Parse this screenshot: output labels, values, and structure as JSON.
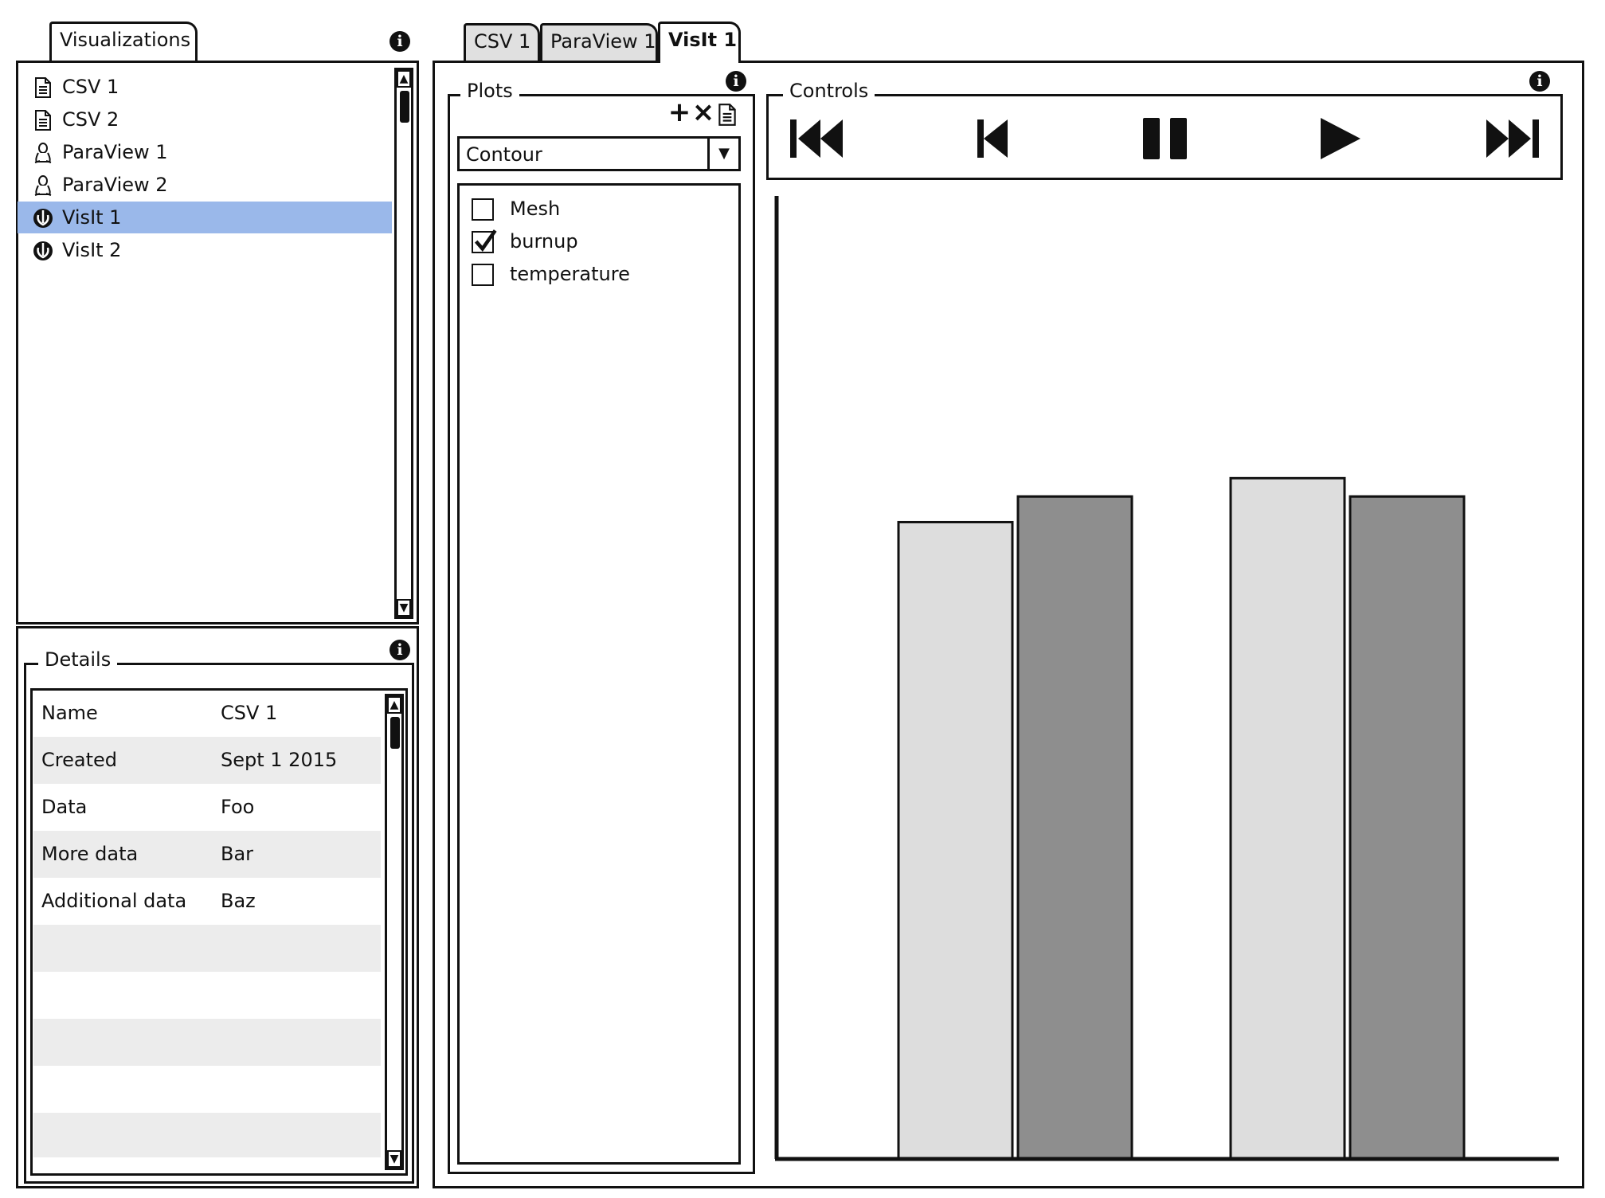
{
  "left_panel": {
    "tab_label": "Visualizations",
    "items": [
      {
        "label": "CSV 1",
        "icon": "document-icon"
      },
      {
        "label": "CSV 2",
        "icon": "document-icon"
      },
      {
        "label": "ParaView 1",
        "icon": "linux-icon"
      },
      {
        "label": "ParaView 2",
        "icon": "linux-icon"
      },
      {
        "label": "VisIt 1",
        "icon": "rebel-icon"
      },
      {
        "label": "VisIt 2",
        "icon": "rebel-icon"
      }
    ],
    "selected_index": 4
  },
  "details": {
    "title": "Details",
    "rows": [
      {
        "key": "Name",
        "value": "CSV 1"
      },
      {
        "key": "Created",
        "value": "Sept 1 2015"
      },
      {
        "key": "Data",
        "value": "Foo"
      },
      {
        "key": "More data",
        "value": "Bar"
      },
      {
        "key": "Additional data",
        "value": "Baz"
      }
    ]
  },
  "tabs": [
    {
      "label": "CSV 1"
    },
    {
      "label": "ParaView 1"
    },
    {
      "label": "VisIt 1",
      "active": true
    }
  ],
  "plots": {
    "title": "Plots",
    "add_label": "+",
    "remove_label": "×",
    "select_value": "Contour",
    "variables": [
      {
        "label": "Mesh",
        "checked": false
      },
      {
        "label": "burnup",
        "checked": true
      },
      {
        "label": "temperature",
        "checked": false
      }
    ]
  },
  "controls": {
    "title": "Controls",
    "buttons": [
      "skip-to-start",
      "step-back",
      "pause",
      "play",
      "skip-to-end"
    ]
  },
  "colors": {
    "selection": "#9ab8ea",
    "bar_light": "#dddddd",
    "bar_dark": "#8e8e8e"
  },
  "chart_data": {
    "type": "bar",
    "categories": [
      "",
      ""
    ],
    "series": [
      {
        "values": [
          87,
          93
        ]
      },
      {
        "values": [
          90.5,
          90.5
        ]
      }
    ],
    "ylim": [
      0,
      100
    ],
    "grid": false
  }
}
